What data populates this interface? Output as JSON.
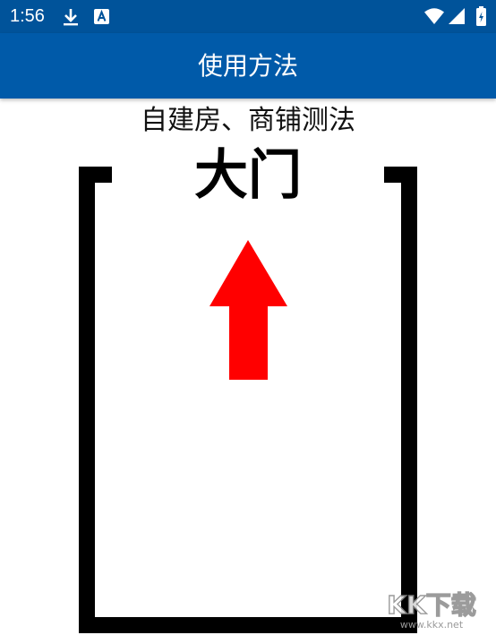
{
  "status_bar": {
    "time": "1:56",
    "icons": [
      "download-icon",
      "accessibility-a-icon",
      "wifi-icon",
      "signal-icon",
      "battery-icon"
    ]
  },
  "app_bar": {
    "title": "使用方法"
  },
  "content": {
    "subtitle": "自建房、商铺测法",
    "door_label": "大门"
  },
  "watermark": {
    "brand": "KK下载",
    "url": "www.kkx.net"
  },
  "colors": {
    "status_bar": "#00539a",
    "app_bar": "#005aa9",
    "arrow": "#ff0000",
    "outline": "#000000"
  }
}
